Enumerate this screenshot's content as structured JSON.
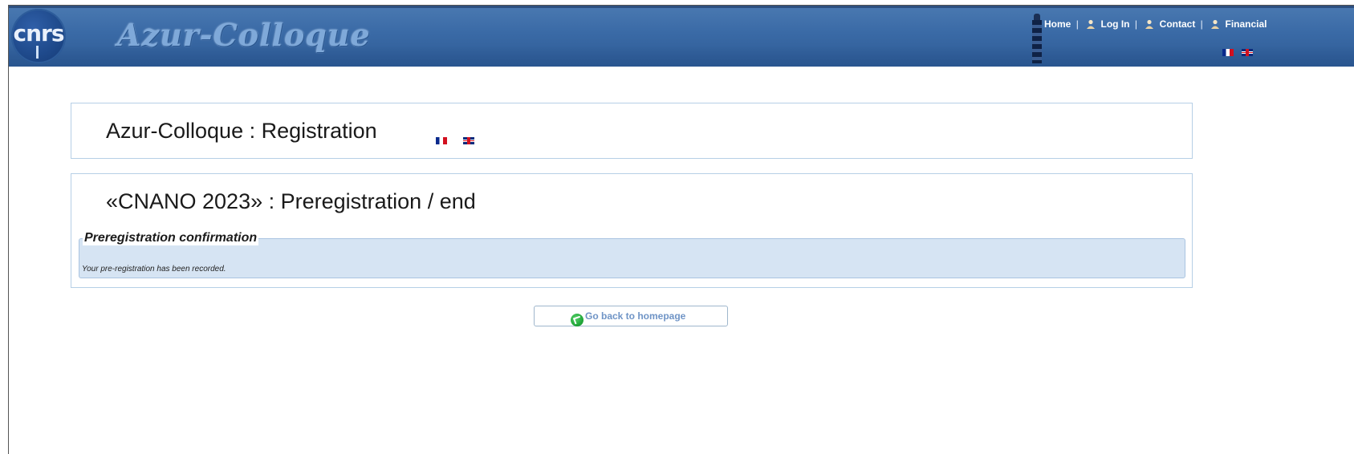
{
  "header": {
    "logo_text": "cnrs",
    "brand": "Azur-Colloque",
    "nav": [
      {
        "label": "Home",
        "icon": "home-icon"
      },
      {
        "label": "Log In",
        "icon": "user-icon"
      },
      {
        "label": "Contact",
        "icon": "user-icon"
      },
      {
        "label": "Financial",
        "icon": "user-icon"
      }
    ],
    "separator": "|",
    "languages": [
      "fr",
      "en"
    ]
  },
  "page": {
    "title": "Azur-Colloque : Registration",
    "subtitle": "«CNANO 2023» : Preregistration / end",
    "confirmation": {
      "legend": "Preregistration confirmation",
      "message": "Your pre-registration has been recorded."
    },
    "back_button": "Go back to homepage"
  },
  "colors": {
    "banner": "#3a6aa6",
    "panel_border": "#b6cfe6",
    "fieldset_bg": "#d6e4f3",
    "link": "#6f94c6"
  }
}
